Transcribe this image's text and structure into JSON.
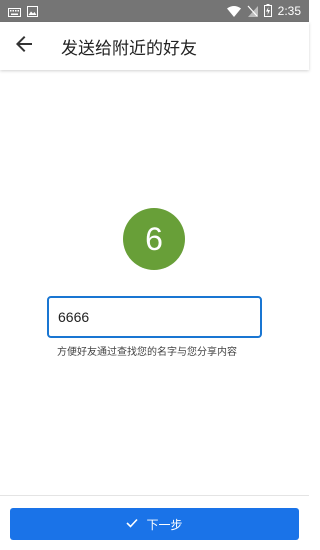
{
  "status_bar": {
    "time": "2:35",
    "left_icons": [
      "keyboard-icon",
      "image-icon"
    ],
    "right_icons": [
      "wifi-icon",
      "no-sim-icon",
      "battery-charging-icon"
    ]
  },
  "app_bar": {
    "back_icon": "arrow-back-icon",
    "title": "发送给附近的好友"
  },
  "main": {
    "code_digit": "6",
    "name_input": {
      "value": "6666"
    },
    "hint": "方便好友通过查找您的名字与您分享内容"
  },
  "footer": {
    "next_label": "下一步",
    "next_icon": "check-icon"
  },
  "colors": {
    "status_bar": "#757575",
    "badge": "#689f38",
    "input_border": "#1976d2",
    "button": "#1a73e8"
  }
}
